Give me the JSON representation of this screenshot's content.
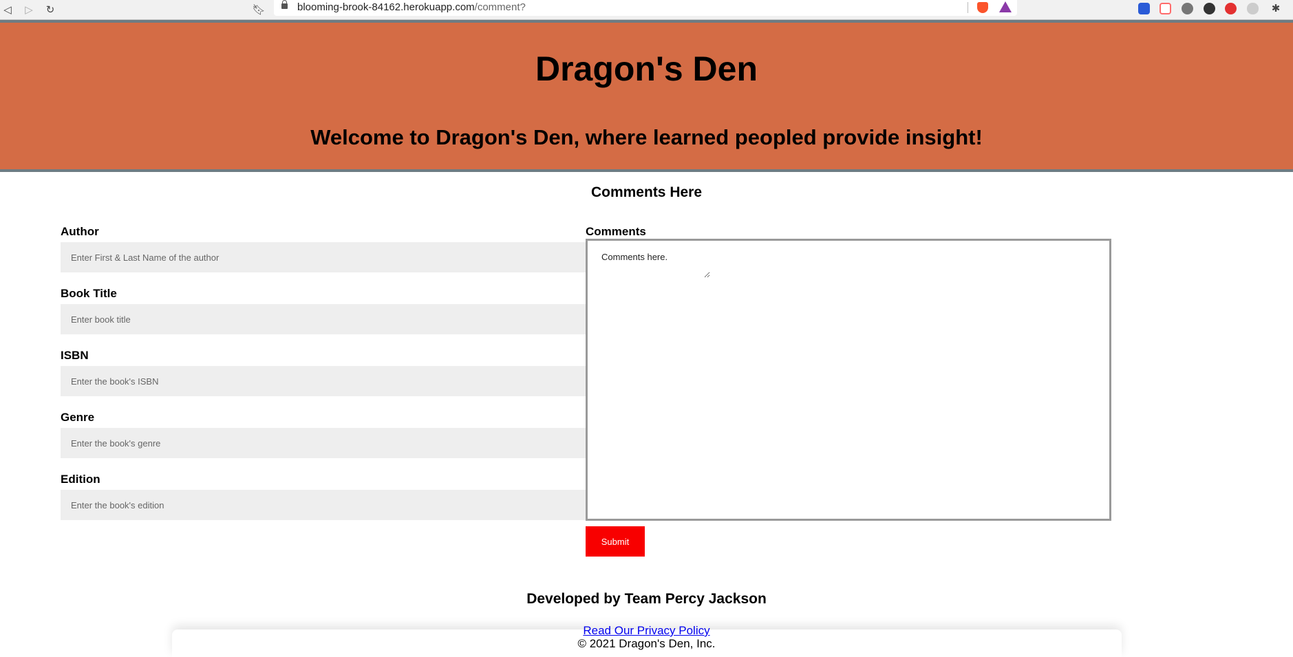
{
  "browser": {
    "url_host": "blooming-brook-84162.herokuapp.com",
    "url_path": "/comment?",
    "back_icon": "back-arrow-icon",
    "forward_icon": "forward-arrow-icon",
    "reload_icon": "reload-icon",
    "bookmark_icon": "bookmark-icon",
    "extension_colors": [
      "#2a5bd7",
      "#ff6b6b",
      "#777777",
      "#333333",
      "#e33030",
      "#bbbbbb",
      "#444444"
    ]
  },
  "header": {
    "title": "Dragon's Den",
    "subtitle": "Welcome to Dragon's Den, where learned peopled provide insight!",
    "background_color": "#d46c45"
  },
  "form": {
    "heading": "Comments Here",
    "fields": [
      {
        "label": "Author",
        "placeholder": "Enter First & Last Name of the author",
        "value": ""
      },
      {
        "label": "Book Title",
        "placeholder": "Enter book title",
        "value": ""
      },
      {
        "label": "ISBN",
        "placeholder": "Enter the book's ISBN",
        "value": ""
      },
      {
        "label": "Genre",
        "placeholder": "Enter the book's genre",
        "value": ""
      },
      {
        "label": "Edition",
        "placeholder": "Enter the book's edition",
        "value": ""
      }
    ],
    "comments_label": "Comments",
    "comments_placeholder": "Comments here.",
    "submit_label": "Submit",
    "submit_color": "#f80000"
  },
  "footer": {
    "developed_by": "Developed by Team Percy Jackson",
    "privacy_link": "Read Our Privacy Policy",
    "copyright": "© 2021 Dragon's Den, Inc."
  }
}
